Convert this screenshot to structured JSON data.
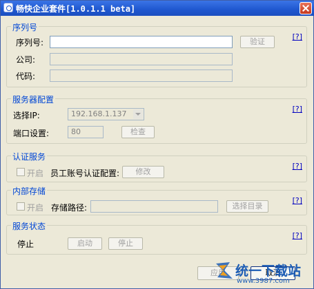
{
  "window": {
    "title": "畅快企业套件[1.0.1.1 beta]"
  },
  "help_link": "[?]",
  "serial_group": {
    "title": "序列号",
    "serial_label": "序列号:",
    "serial_value": "",
    "verify_button": "验证",
    "company_label": "公司:",
    "company_value": "",
    "code_label": "代码:",
    "code_value": ""
  },
  "server_group": {
    "title": "服务器配置",
    "ip_label": "选择IP:",
    "ip_value": "192.168.1.137",
    "port_label": "端口设置:",
    "port_value": "80",
    "check_button": "检查"
  },
  "auth_group": {
    "title": "认证服务",
    "enable_label": "开启",
    "enable_checked": false,
    "account_label": "员工账号认证配置:",
    "modify_button": "修改"
  },
  "storage_group": {
    "title": "内部存储",
    "enable_label": "开启",
    "enable_checked": false,
    "path_label": "存储路径:",
    "path_value": "",
    "browse_button": "选择目录"
  },
  "status_group": {
    "title": "服务状态",
    "status_text": "停止",
    "start_button": "启动",
    "stop_button": "停止"
  },
  "footer": {
    "apply_button": "应用",
    "cancel_button": "取消"
  },
  "watermark": {
    "text": "统一下载站",
    "url": "www.3987.com"
  }
}
